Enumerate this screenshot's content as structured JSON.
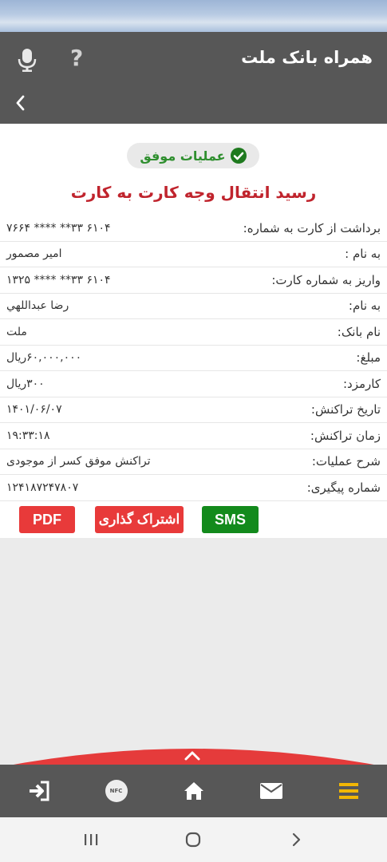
{
  "header": {
    "title": "همراه بانک ملت",
    "help_label": "?"
  },
  "status": {
    "label": "عملیات موفق",
    "color": "#2f8f2f"
  },
  "receipt": {
    "title": "رسید انتقال وجه کارت به کارت",
    "rows": [
      {
        "label": "برداشت از کارت به شماره:",
        "value": "۶۱۰۴ ۳۳** **** ۷۶۶۴"
      },
      {
        "label": "به نام :",
        "value": "امیر مصمور"
      },
      {
        "label": "واریز به شماره کارت:",
        "value": "۶۱۰۴ ۳۳** **** ۱۳۲۵"
      },
      {
        "label": "به نام:",
        "value": "رضا عبداللهي"
      },
      {
        "label": "نام بانک:",
        "value": "ملت"
      },
      {
        "label": "مبلغ:",
        "value": "۶۰,۰۰۰,۰۰۰ریال"
      },
      {
        "label": "کارمزد:",
        "value": "۳۰۰ریال"
      },
      {
        "label": "تاریخ تراکنش:",
        "value": "۱۴۰۱/۰۶/۰۷"
      },
      {
        "label": "زمان تراکنش:",
        "value": "۱۹:۳۳:۱۸"
      },
      {
        "label": "شرح عملیات:",
        "value": "تراکنش موفق کسر از موجودی"
      },
      {
        "label": "شماره پیگیری:",
        "value": "۱۲۴۱۸۷۲۴۷۸۰۷"
      }
    ]
  },
  "actions": {
    "pdf_label": "PDF",
    "share_label": "اشتراک گذاری",
    "sms_label": "SMS"
  },
  "bottom_nav": {
    "items": [
      "logout-icon",
      "nfc-icon",
      "home-icon",
      "mail-icon",
      "menu-icon"
    ],
    "nfc_label": "NFC",
    "accent_color": "#f2b705"
  },
  "colors": {
    "header_bg": "#575757",
    "title_red": "#c0242d",
    "button_red": "#e83a3a",
    "button_green": "#138a1c"
  }
}
